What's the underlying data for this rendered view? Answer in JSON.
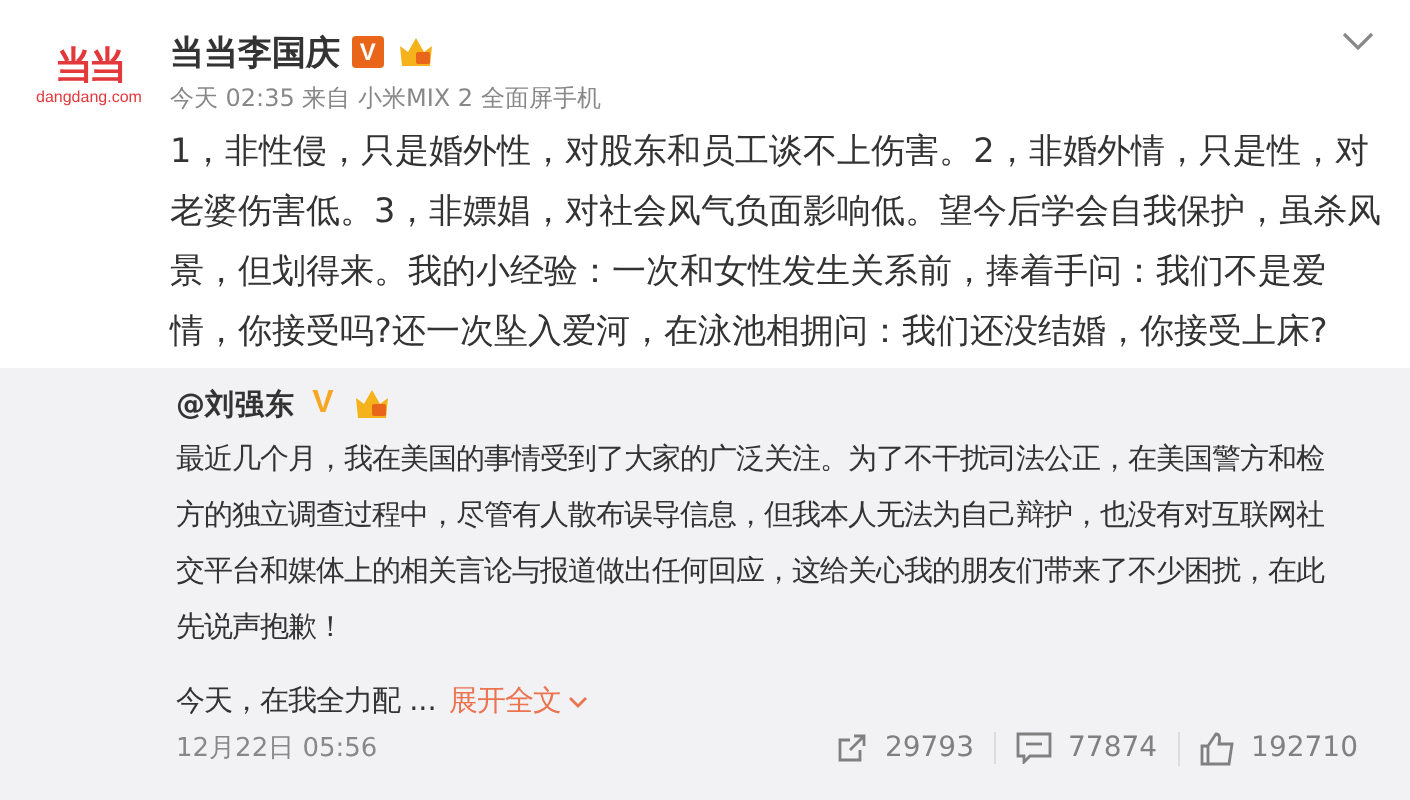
{
  "post": {
    "avatar": {
      "logo": "当当",
      "site": "dangdang.com"
    },
    "author": "当当李国庆",
    "verified_mark": "V",
    "meta": "今天 02:35 来自 小米MIX 2 全面屏手机",
    "text": "1，非性侵，只是婚外性，对股东和员工谈不上伤害。2，非婚外情，只是性，对老婆伤害低。3，非嫖娼，对社会风气负面影响低。望今后学会自我保护，虽杀风景，但划得来。我的小经验：一次和女性发生关系前，捧着手问：我们不是爱情，你接受吗?还一次坠入爱河，在泳池相拥问：我们还没结婚，你接受上床?"
  },
  "repost": {
    "author": "@刘强东",
    "verified_mark": "V",
    "paragraphs": [
      "最近几个月，我在美国的事情受到了大家的广泛关注。为了不干扰司法公正，在美国警方和检方的独立调查过程中，尽管有人散布误导信息，但我本人无法为自己辩护，也没有对互联网社交平台和媒体上的相关言论与报道做出任何回应，这给关心我的朋友们带来了不少困扰，在此先说声抱歉！",
      "今天，在我全力配 ..."
    ],
    "expand_link": "展开全文",
    "date": "12月22日 05:56",
    "stats": [
      {
        "kind": "share",
        "count": "29793"
      },
      {
        "kind": "comment",
        "count": "77874"
      },
      {
        "kind": "like",
        "count": "192710"
      }
    ]
  }
}
